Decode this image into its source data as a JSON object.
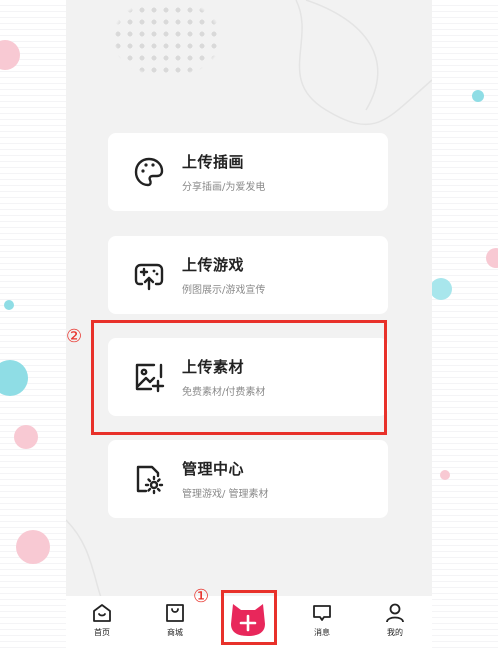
{
  "colors": {
    "accent": "#e8275b",
    "highlight": "#e8312a",
    "phone_bg": "#f2f2f2",
    "card_bg": "#ffffff",
    "text": "#222222",
    "subtext": "#8a8a8a"
  },
  "cards": [
    {
      "icon": "palette-icon",
      "title": "上传插画",
      "subtitle": "分享插画/为爱发电"
    },
    {
      "icon": "gamepad-upload-icon",
      "title": "上传游戏",
      "subtitle": "例图展示/游戏宣传"
    },
    {
      "icon": "image-add-icon",
      "title": "上传素材",
      "subtitle": "免费素材/付费素材"
    },
    {
      "icon": "settings-file-icon",
      "title": "管理中心",
      "subtitle": "管理游戏/ 管理素材"
    }
  ],
  "nav": {
    "items": [
      {
        "icon": "home-icon",
        "label": "首页"
      },
      {
        "icon": "shop-bag-icon",
        "label": "商城"
      },
      {
        "icon": "plus-cat-icon",
        "label": ""
      },
      {
        "icon": "message-icon",
        "label": "消息"
      },
      {
        "icon": "user-icon",
        "label": "我的"
      }
    ]
  },
  "annotations": {
    "marker_1": "①",
    "marker_2": "②"
  }
}
